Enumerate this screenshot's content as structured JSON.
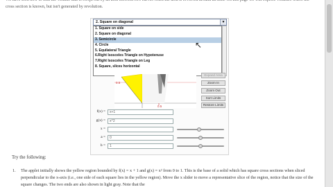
{
  "intro": {
    "text": "We have seen how to find the volume that is swept out by an area between two curves when the area is revolved around an axis. On this page we will explore volumes where the cross section is known, but isn't generated by revolution."
  },
  "dropdown": {
    "selected": "2. Square on diagonal",
    "options": [
      "1. Square on side",
      "2. Square on diagonal",
      "3. Semicircle",
      "4. Circle",
      "5. Equilateral Triangle",
      "6.Right Isosceles Triangle on Hypotenuse",
      "7.Right Isosceles Triangle on Leg",
      "8. Square, slices horizontal"
    ],
    "highlighted_index": 2
  },
  "graph": {
    "y_label": "0.5",
    "x_label": "0.5",
    "region_color": "#fff200"
  },
  "buttons": {
    "hidden": "Expand Area",
    "zoom_in": "Zoom In",
    "zoom_out": "Zoom Out",
    "sort_limits": "Sort Limits",
    "restore_limits": "Restore Limits"
  },
  "fields": {
    "f_label": "f(x) =",
    "f_value": "x+1",
    "g_label": "g(x) =",
    "g_value": "x^2",
    "x_label": "x =",
    "x_value": "",
    "a_label": "a =",
    "a_value": "0",
    "b_label": "b =",
    "b_value": "1"
  },
  "sliders": {
    "x_level": 0.47,
    "a_level": 0.5,
    "b_level": 0.5
  },
  "instructions": {
    "heading": "Try the following:",
    "step1_num": "1.",
    "step1": "The applet initially shows the yellow region bounded by f(x) = x + 1 and g(x) = x² from 0 to 1. This is the base of a solid which has square cross sections when sliced perpendicular to the x-axis (i.e., one side of each square lies in the yellow region). Move the x slider to move a representative slice of the region, notice that the size of the square changes. The two ends are also shown in light gray. Note that the"
  },
  "colors": {
    "yellow": "#fff200",
    "highlight": "#b8cfe5"
  }
}
